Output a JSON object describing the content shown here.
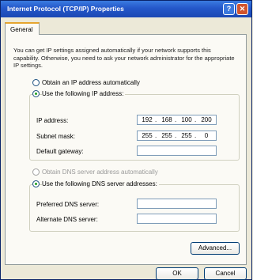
{
  "window": {
    "title": "Internet Protocol (TCP/IP) Properties",
    "help_glyph": "?",
    "close_glyph": "✕"
  },
  "tabs": [
    {
      "label": "General"
    }
  ],
  "description": "You can get IP settings assigned automatically if your network supports this capability. Otherwise, you need to ask your network administrator for the appropriate IP settings.",
  "ip_mode": {
    "auto_label": "Obtain an IP address automatically",
    "manual_label": "Use the following IP address:",
    "selected": "manual"
  },
  "ip_fields": {
    "ip_label": "IP address:",
    "ip_value": [
      "192",
      "168",
      "100",
      "200"
    ],
    "mask_label": "Subnet mask:",
    "mask_value": [
      "255",
      "255",
      "255",
      "0"
    ],
    "gateway_label": "Default gateway:",
    "gateway_value": ""
  },
  "dns_mode": {
    "auto_label": "Obtain DNS server address automatically",
    "manual_label": "Use the following DNS server addresses:",
    "selected": "manual"
  },
  "dns_fields": {
    "preferred_label": "Preferred DNS server:",
    "alternate_label": "Alternate DNS server:"
  },
  "buttons": {
    "advanced": "Advanced...",
    "ok": "OK",
    "cancel": "Cancel"
  },
  "colors": {
    "titlebar": "#2457c9",
    "window_bg": "#ece9d8",
    "tab_highlight": "#e6a52f",
    "radio_selected": "#21a121"
  }
}
